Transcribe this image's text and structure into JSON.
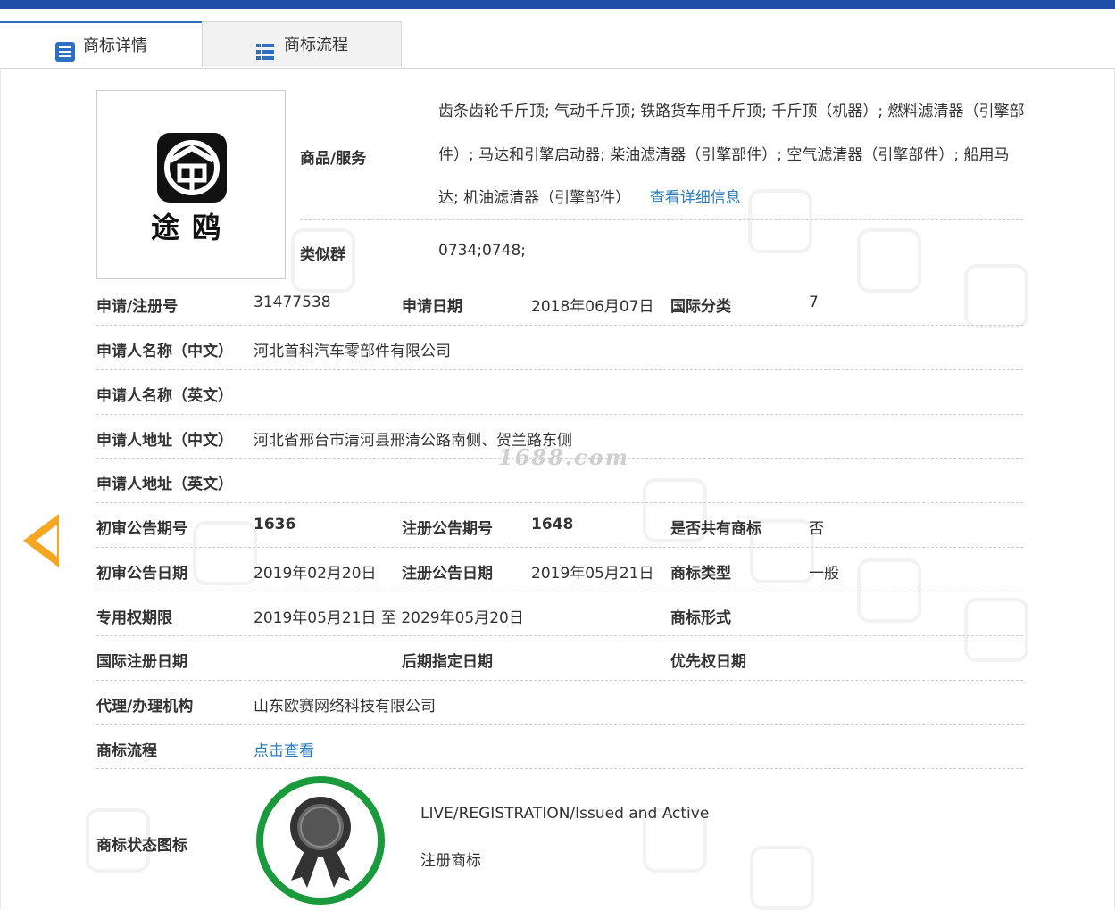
{
  "tabs": [
    {
      "label": "商标详情",
      "icon": "detail-list-icon",
      "active": true
    },
    {
      "label": "商标流程",
      "icon": "grid-list-icon",
      "active": false
    }
  ],
  "colors": {
    "accent": "#2f6fc1",
    "link": "#2a7ec0",
    "arrow": "#f5a623",
    "badge_green": "#1a9a3c",
    "topbar": "#1f4ea8"
  },
  "logo": {
    "text": "途鸥"
  },
  "goods": {
    "label": "商品/服务",
    "text": "齿条齿轮千斤顶; 气动千斤顶; 铁路货车用千斤顶; 千斤顶（机器）; 燃料滤清器（引擎部件）; 马达和引擎启动器; 柴油滤清器（引擎部件）; 空气滤清器（引擎部件）; 船用马达; 机油滤清器（引擎部件）",
    "more_link": "查看详细信息"
  },
  "similar_group": {
    "label": "类似群",
    "value": "0734;0748;"
  },
  "fields": {
    "reg_no": {
      "label": "申请/注册号",
      "value": "31477538"
    },
    "apply_date": {
      "label": "申请日期",
      "value": "2018年06月07日"
    },
    "intl_class": {
      "label": "国际分类",
      "value": "7"
    },
    "applicant_cn": {
      "label": "申请人名称（中文）",
      "value": "河北首科汽车零部件有限公司"
    },
    "applicant_en": {
      "label": "申请人名称（英文）",
      "value": ""
    },
    "address_cn": {
      "label": "申请人地址（中文）",
      "value": "河北省邢台市清河县邢清公路南侧、贺兰路东侧"
    },
    "address_en": {
      "label": "申请人地址（英文）",
      "value": ""
    },
    "prelim_issue": {
      "label": "初审公告期号",
      "value": "1636"
    },
    "reg_issue": {
      "label": "注册公告期号",
      "value": "1648"
    },
    "shared": {
      "label": "是否共有商标",
      "value": "否"
    },
    "prelim_date": {
      "label": "初审公告日期",
      "value": "2019年02月20日"
    },
    "reg_date": {
      "label": "注册公告日期",
      "value": "2019年05月21日"
    },
    "tm_type": {
      "label": "商标类型",
      "value": "一般"
    },
    "exclusive": {
      "label": "专用权期限",
      "value": "2019年05月21日 至 2029年05月20日"
    },
    "tm_form": {
      "label": "商标形式",
      "value": ""
    },
    "intl_reg_date": {
      "label": "国际注册日期",
      "value": ""
    },
    "later_date": {
      "label": "后期指定日期",
      "value": ""
    },
    "priority_date": {
      "label": "优先权日期",
      "value": ""
    },
    "agent": {
      "label": "代理/办理机构",
      "value": "山东欧赛网络科技有限公司"
    },
    "process": {
      "label": "商标流程",
      "value": "点击查看"
    }
  },
  "status": {
    "label": "商标状态图标",
    "line1": "LIVE/REGISTRATION/Issued and Active",
    "line2": "注册商标"
  },
  "watermark": {
    "domain": "1688.com"
  }
}
